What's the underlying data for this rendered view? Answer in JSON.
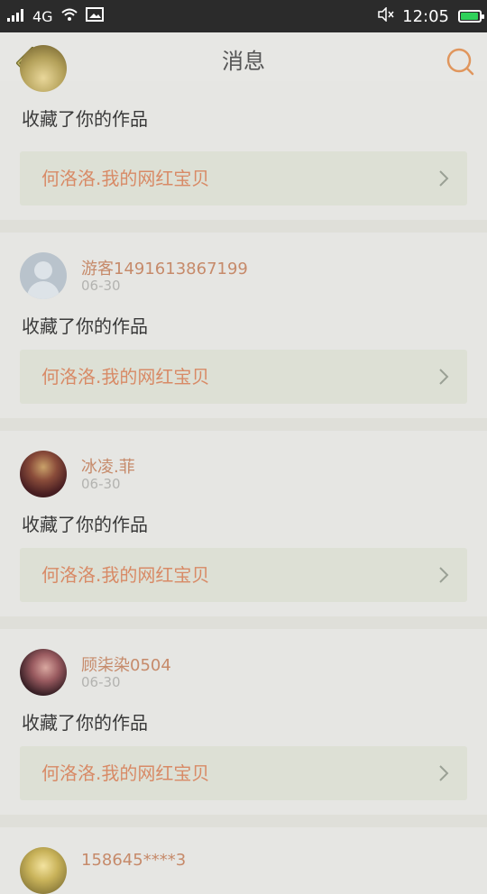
{
  "status_bar": {
    "network": "4G",
    "time": "12:05"
  },
  "nav": {
    "title": "消息"
  },
  "action_text": "收藏了你的作品",
  "work_title": "何洛洛.我的网红宝贝",
  "items": [
    {
      "username": "",
      "date": "",
      "action": "收藏了你的作品",
      "work": "何洛洛.我的网红宝贝"
    },
    {
      "username": "游客1491613867199",
      "date": "06-30",
      "action": "收藏了你的作品",
      "work": "何洛洛.我的网红宝贝"
    },
    {
      "username": "冰凌.菲",
      "date": "06-30",
      "action": "收藏了你的作品",
      "work": "何洛洛.我的网红宝贝"
    },
    {
      "username": "顾柒染0504",
      "date": "06-30",
      "action": "收藏了你的作品",
      "work": "何洛洛.我的网红宝贝"
    },
    {
      "username": "158645****3",
      "date": "",
      "action": "",
      "work": ""
    }
  ],
  "icons": {
    "back": "back-arrow-icon",
    "search": "search-icon",
    "chevron": "chevron-right-icon"
  },
  "colors": {
    "username": "#c68a6a",
    "work_title": "#d88a66",
    "work_box_bg": "#dde0d5",
    "status_bar_bg": "#2b2b2b",
    "battery_fill": "#2fd15a"
  }
}
